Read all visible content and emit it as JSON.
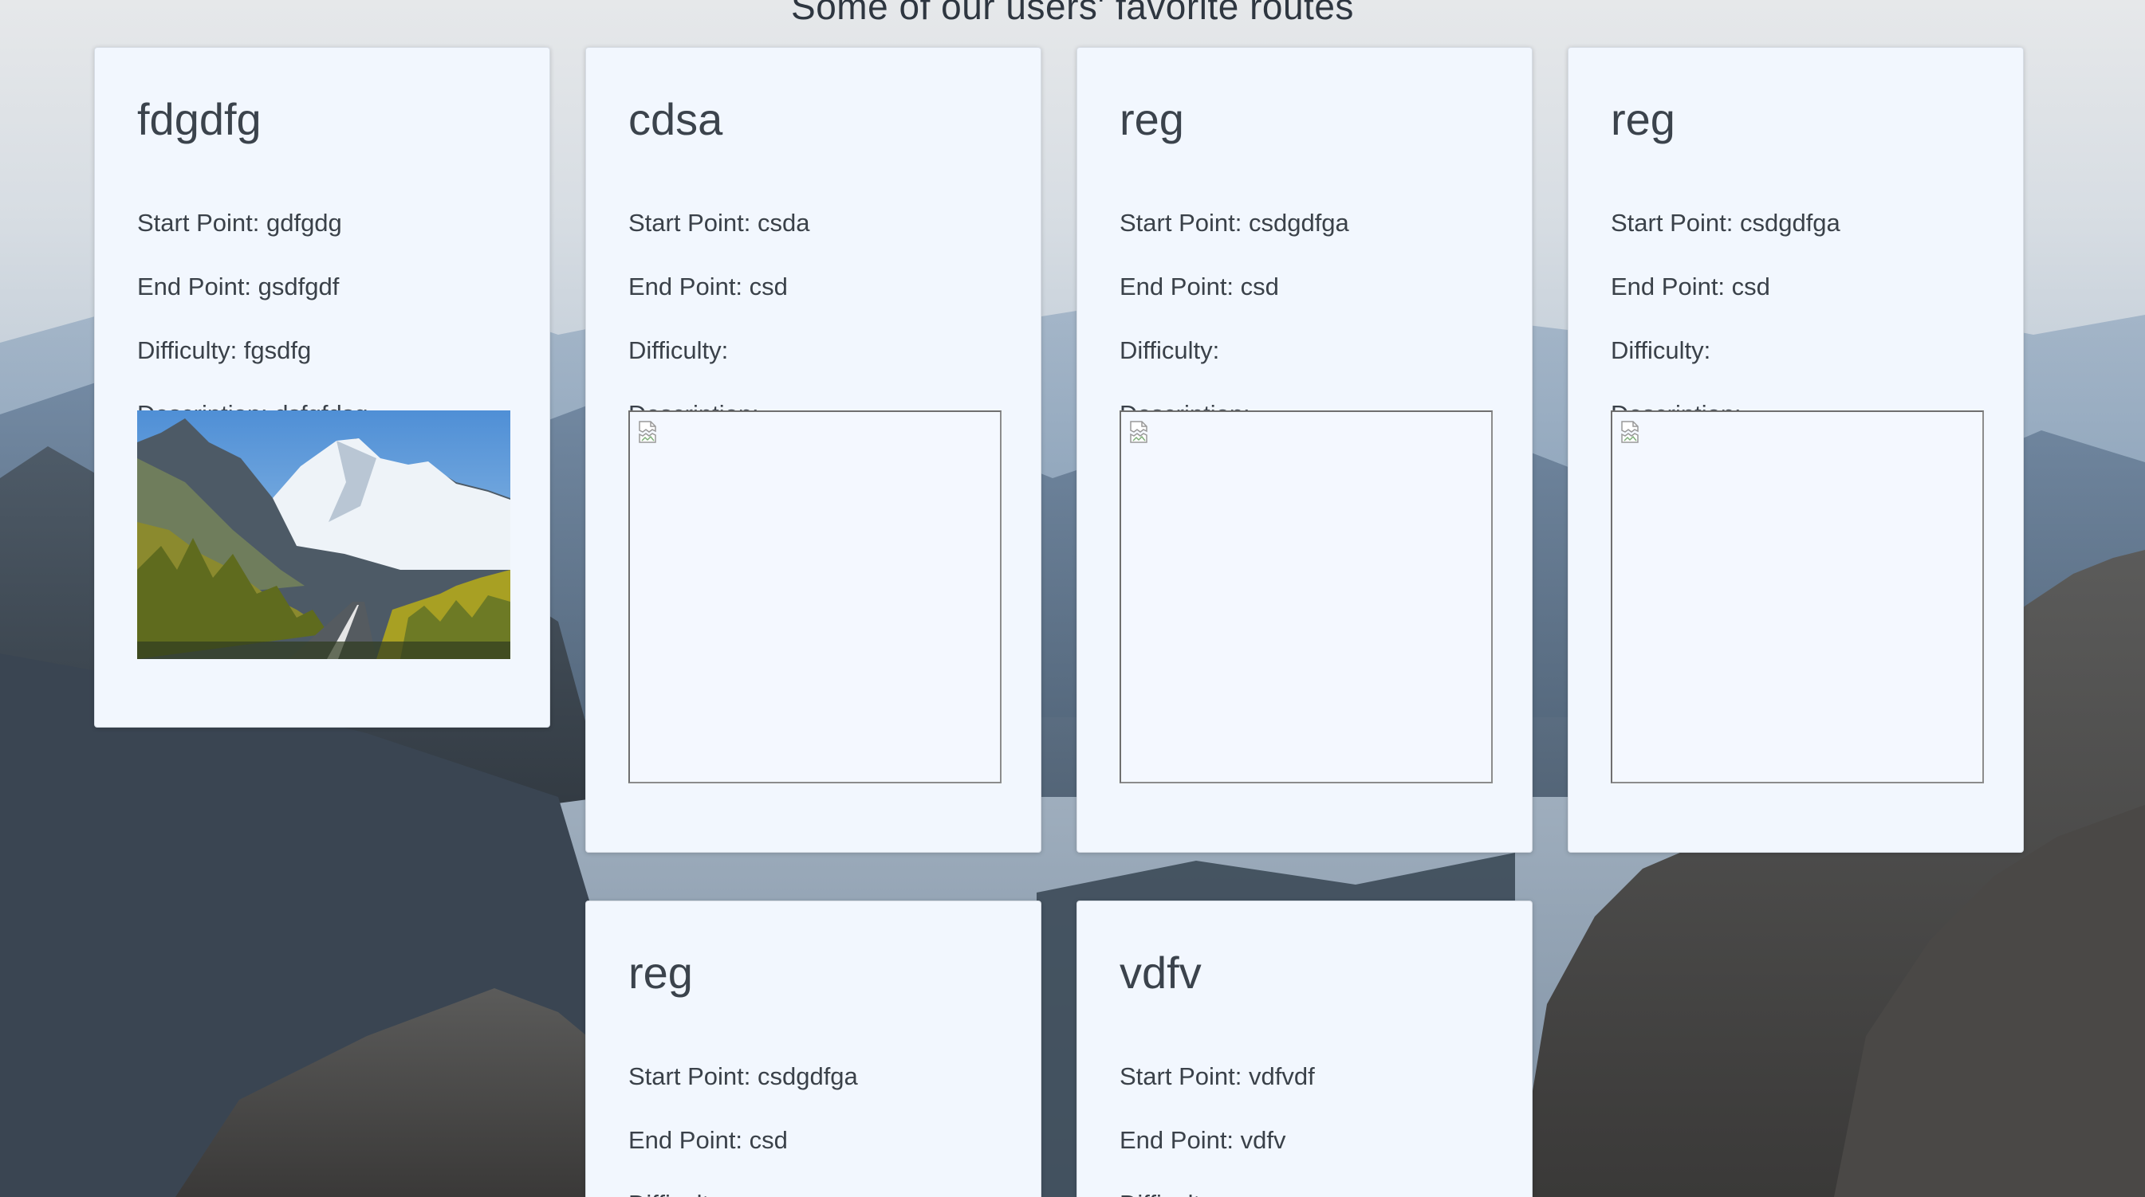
{
  "page": {
    "title": "Some of our users' favorite routes"
  },
  "labels": {
    "start": "Start Point: ",
    "end": "End Point: ",
    "difficulty": "Difficulty: ",
    "description": "Description: "
  },
  "routes": [
    {
      "name": "fdgdfg",
      "start": "gdfgdg",
      "end": "gsdfgdf",
      "difficulty": "fgsdfg",
      "description": "dsfgfdsg",
      "image": "mountain-road-photo"
    },
    {
      "name": "cdsa",
      "start": "csda",
      "end": "csd",
      "difficulty": "",
      "description": "",
      "image": "broken-image-icon"
    },
    {
      "name": "reg",
      "start": "csdgdfga",
      "end": "csd",
      "difficulty": "",
      "description": "",
      "image": "broken-image-icon"
    },
    {
      "name": "reg",
      "start": "csdgdfga",
      "end": "csd",
      "difficulty": "",
      "description": "",
      "image": "broken-image-icon"
    },
    {
      "name": "reg",
      "start": "csdgdfga",
      "end": "csd",
      "difficulty": "",
      "description": "",
      "image": "broken-image-icon"
    },
    {
      "name": "vdfv",
      "start": "vdfvdf",
      "end": "vdfv",
      "difficulty": "",
      "description": "",
      "image": "broken-image-icon"
    }
  ],
  "colors": {
    "card_background": "#f2f7fe",
    "text": "#3a4149"
  }
}
